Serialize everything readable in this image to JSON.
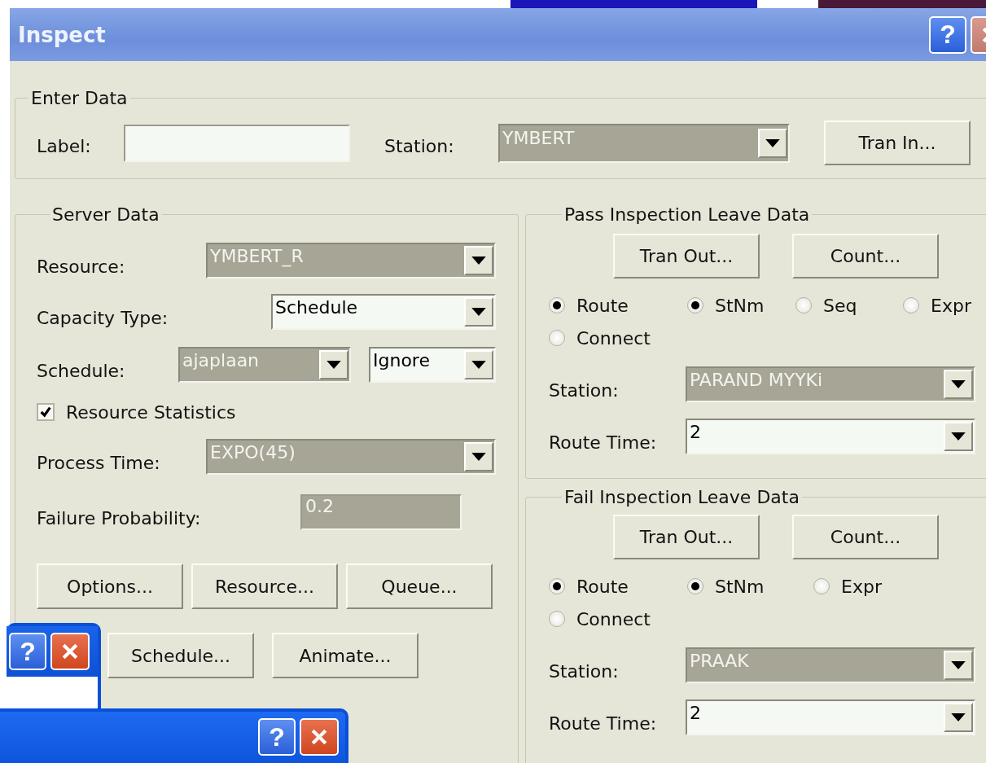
{
  "window": {
    "title": "Inspect",
    "help": "?"
  },
  "enter_data": {
    "title": "Enter Data",
    "label_field": {
      "label": "Label:"
    },
    "station": {
      "label": "Station:",
      "value": "YMBERT",
      "disabled": true
    },
    "tran_in_button": "Tran In..."
  },
  "server_data": {
    "title": "Server Data",
    "resource": {
      "label": "Resource:",
      "value": "YMBERT_R",
      "disabled": true
    },
    "capacity_type": {
      "label": "Capacity Type:",
      "value": "Schedule",
      "disabled": false
    },
    "schedule": {
      "label": "Schedule:",
      "value": "ajaplaan",
      "disabled": true,
      "rule": {
        "value": "Ignore",
        "disabled": false
      }
    },
    "resource_statistics": {
      "label": "Resource Statistics",
      "checked": true
    },
    "process_time": {
      "label": "Process Time:",
      "value": "EXPO(45)",
      "disabled": true
    },
    "failure_probability": {
      "label": "Failure Probability:",
      "value": "0.2",
      "disabled": true
    },
    "buttons": [
      "Options...",
      "Resource...",
      "Queue...",
      "Schedule...",
      "Animate..."
    ]
  },
  "leave_sections": [
    {
      "title": "Pass Inspection Leave Data",
      "buttons": [
        "Tran Out...",
        "Count..."
      ],
      "radios": [
        {
          "label": "Route",
          "selected": true
        },
        {
          "label": "StNm",
          "selected": true
        },
        {
          "label": "Seq",
          "selected": false
        },
        {
          "label": "Expr",
          "selected": false
        },
        {
          "label": "Connect",
          "selected": false
        }
      ],
      "station": {
        "label": "Station:",
        "value": "PARAND MYYKi",
        "disabled": true
      },
      "route_time": {
        "label": "Route Time:",
        "value": "2",
        "disabled": false
      }
    },
    {
      "title": "Fail Inspection Leave Data",
      "buttons": [
        "Tran Out...",
        "Count..."
      ],
      "radios": [
        {
          "label": "Route",
          "selected": true
        },
        {
          "label": "StNm",
          "selected": true
        },
        {
          "label": "Expr",
          "selected": false
        },
        {
          "label": "Connect",
          "selected": false
        }
      ],
      "station": {
        "label": "Station:",
        "value": "PRAAK",
        "disabled": true
      },
      "route_time": {
        "label": "Route Time:",
        "value": "2",
        "disabled": false
      }
    }
  ],
  "overlapping_windows": [
    {
      "kind": "small",
      "help": "?"
    },
    {
      "kind": "wide",
      "help": "?"
    }
  ]
}
